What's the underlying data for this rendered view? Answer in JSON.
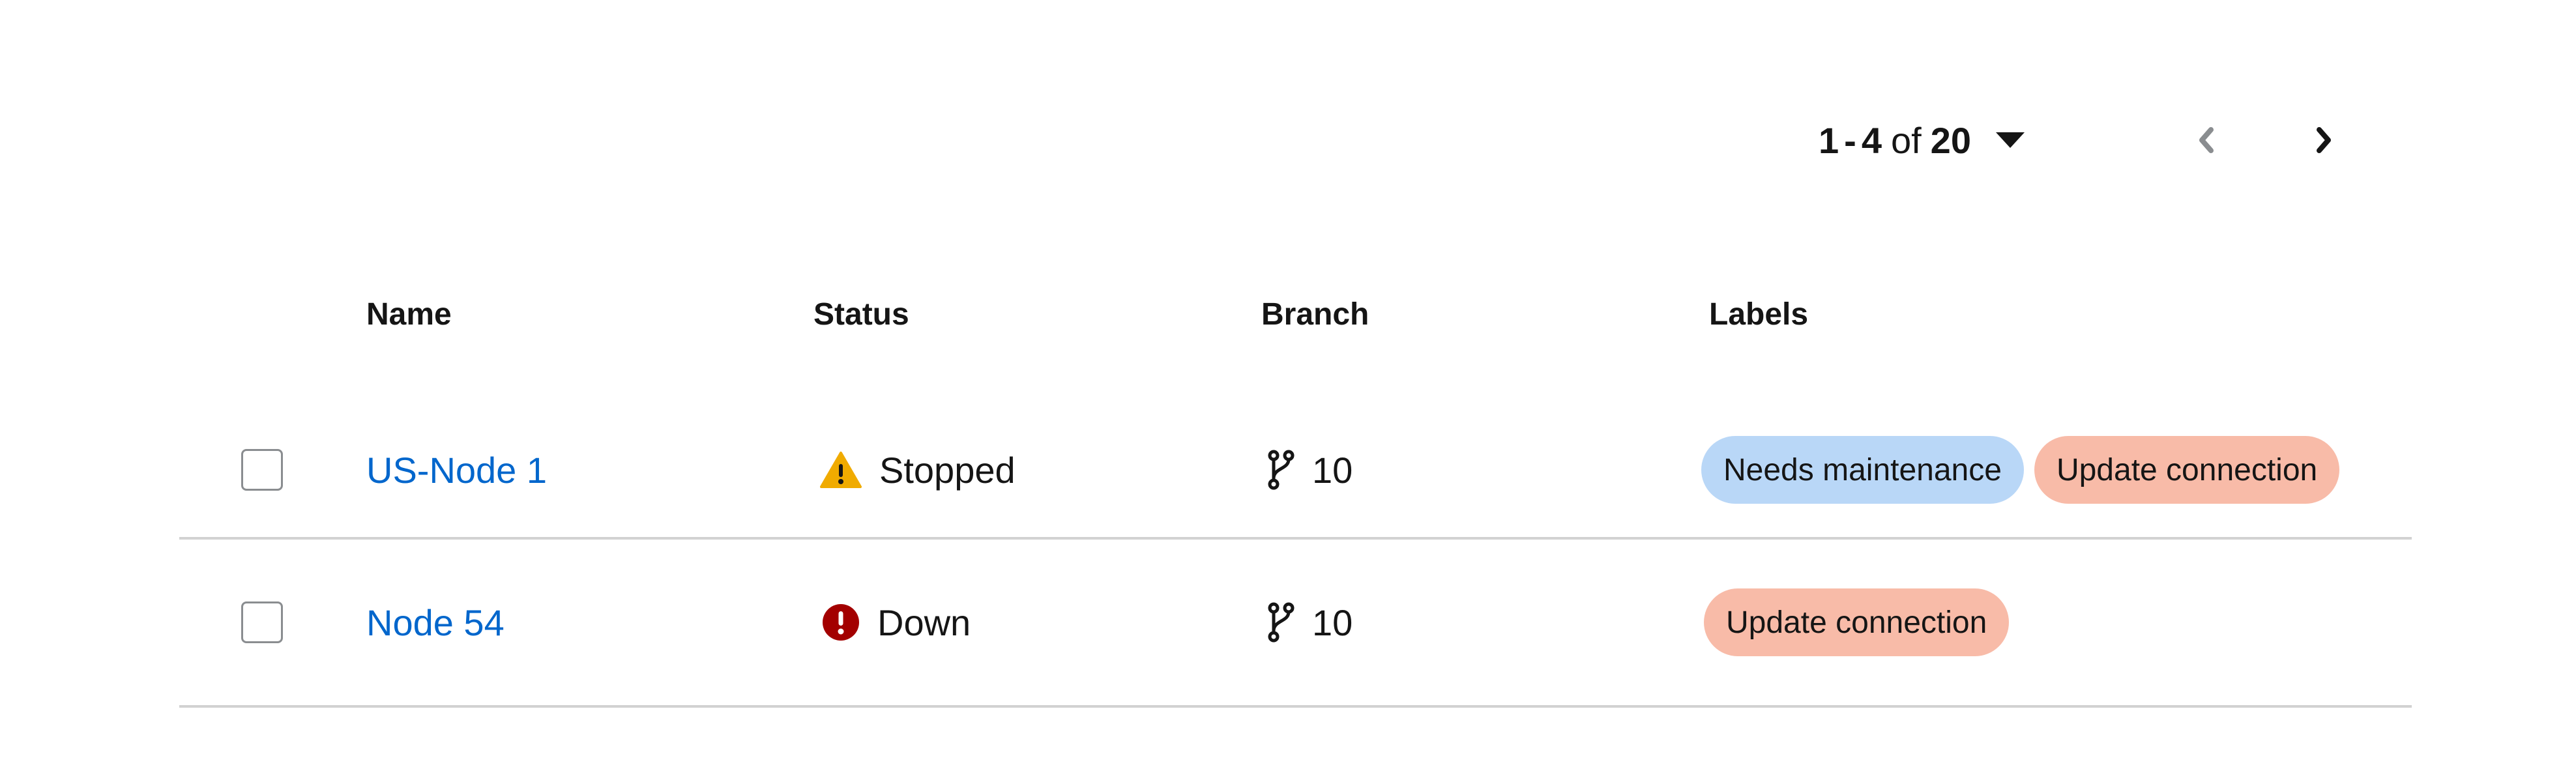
{
  "pagination": {
    "range_start": "1",
    "range_dash": "-",
    "range_end": "4",
    "of_label": "of",
    "total": "20",
    "prev_icon": "chevron-left-icon",
    "next_icon": "chevron-right-icon",
    "prev_disabled": true
  },
  "table": {
    "columns": {
      "name": "Name",
      "status": "Status",
      "branch": "Branch",
      "labels": "Labels"
    },
    "rows": [
      {
        "name": "US-Node 1",
        "status": "Stopped",
        "status_icon": "warning-triangle-icon",
        "branch_icon": "code-branch-icon",
        "branch": "10",
        "labels": [
          {
            "text": "Needs maintenance",
            "color": "#b9d7f7"
          },
          {
            "text": "Update connection",
            "color": "#f8bba8"
          }
        ]
      },
      {
        "name": "Node 54",
        "status": "Down",
        "status_icon": "error-circle-icon",
        "branch_icon": "code-branch-icon",
        "branch": "10",
        "labels": [
          {
            "text": "Update connection",
            "color": "#f8bba8"
          }
        ]
      }
    ]
  },
  "colors": {
    "link": "#0066cc",
    "warning": "#f0ab00",
    "danger": "#a30000",
    "divider": "#d2d2d2"
  }
}
